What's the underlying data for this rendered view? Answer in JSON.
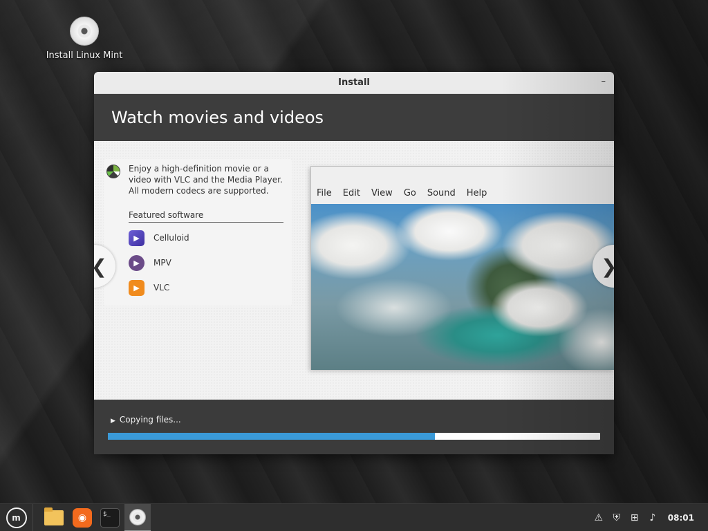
{
  "desktop": {
    "icon_label": "Install Linux Mint"
  },
  "window": {
    "title": "Install",
    "minimize_symbol": "–"
  },
  "slide": {
    "heading": "Watch movies and videos",
    "description": "Enjoy a high-definition movie or a video with VLC and the Media Player. All modern codecs are supported.",
    "featured_label": "Featured software",
    "apps": [
      {
        "name": "Celluloid",
        "icon": "celluloid-icon"
      },
      {
        "name": "MPV",
        "icon": "mpv-icon"
      },
      {
        "name": "VLC",
        "icon": "vlc-icon"
      }
    ],
    "prev_symbol": "❮",
    "next_symbol": "❯",
    "player_menu": [
      "File",
      "Edit",
      "View",
      "Go",
      "Sound",
      "Help"
    ]
  },
  "progress": {
    "status": "Copying files...",
    "fraction": 0.665,
    "color": "#3a9ad8"
  },
  "taskbar": {
    "clock": "08:01",
    "launchers": [
      "menu-icon",
      "files-icon",
      "firefox-icon",
      "terminal-icon",
      "install-icon"
    ],
    "tray": [
      "update-icon",
      "shield-icon",
      "network-icon",
      "volume-icon"
    ]
  }
}
